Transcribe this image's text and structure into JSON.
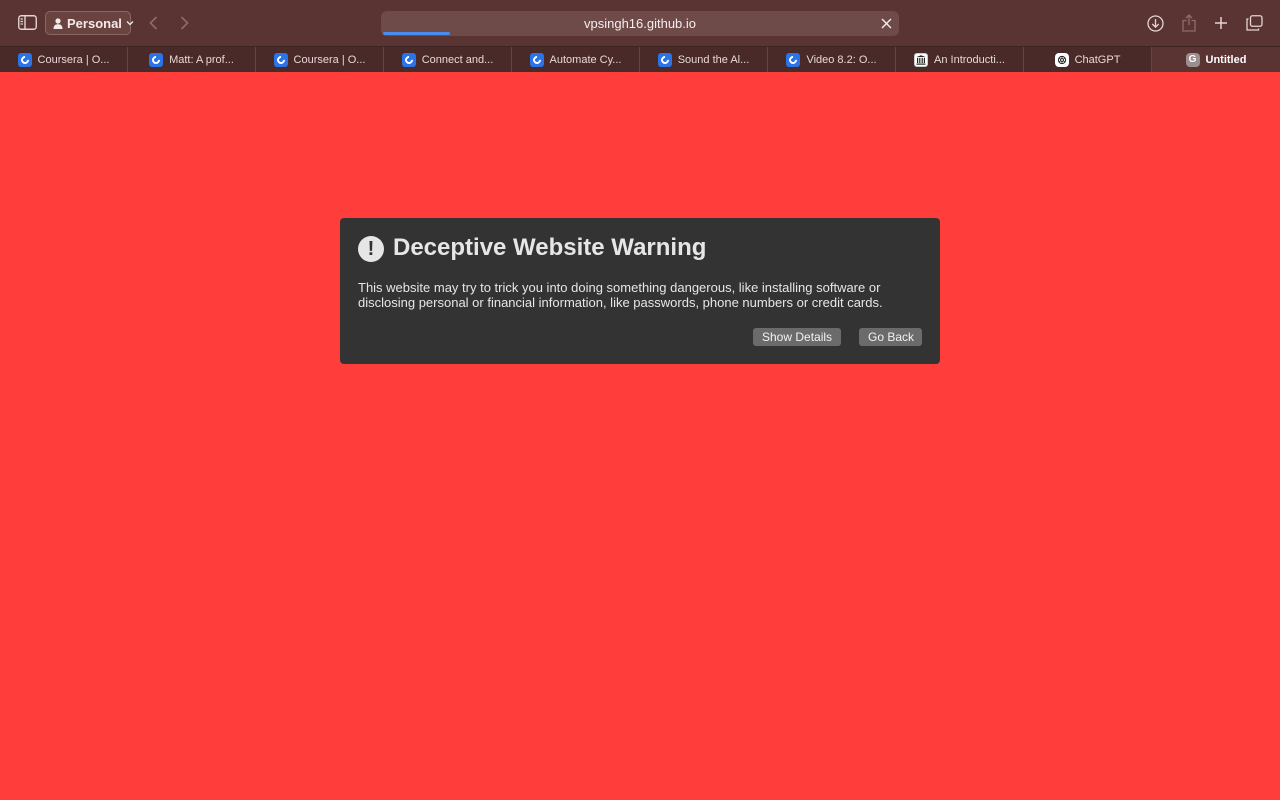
{
  "toolbar": {
    "profile_label": "Personal",
    "address": "vpsingh16.github.io",
    "load_progress": 0.13
  },
  "tabs": [
    {
      "label": "Coursera | O...",
      "favicon": "coursera-icon",
      "active": false
    },
    {
      "label": "Matt: A prof...",
      "favicon": "coursera-icon",
      "active": false
    },
    {
      "label": "Coursera | O...",
      "favicon": "coursera-icon",
      "active": false
    },
    {
      "label": "Connect and...",
      "favicon": "coursera-icon",
      "active": false
    },
    {
      "label": "Automate Cy...",
      "favicon": "coursera-icon",
      "active": false
    },
    {
      "label": "Sound the Al...",
      "favicon": "coursera-icon",
      "active": false
    },
    {
      "label": "Video 8.2: O...",
      "favicon": "coursera-icon",
      "active": false
    },
    {
      "label": "An Introducti...",
      "favicon": "library-icon",
      "active": false
    },
    {
      "label": "ChatGPT",
      "favicon": "chatgpt-icon",
      "active": false
    },
    {
      "label": "Untitled",
      "favicon": "g-icon",
      "active": true
    }
  ],
  "warning": {
    "title": "Deceptive Website Warning",
    "body": "This website may try to trick you into doing something dangerous, like installing software or disclosing personal or financial information, like passwords, phone numbers or credit cards.",
    "show_details_label": "Show Details",
    "go_back_label": "Go Back"
  },
  "colors": {
    "page_background": "#ff3d3a",
    "toolbar": "#5a3432",
    "dialog": "#333333",
    "progress": "#4a8bf0"
  }
}
